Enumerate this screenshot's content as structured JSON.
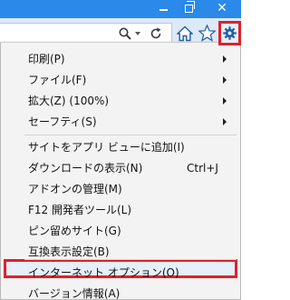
{
  "browser": {
    "window_controls": {
      "minimize": "minimize-icon",
      "restore": "restore-icon",
      "close": "✕"
    },
    "toolbar": {
      "address_icons": [
        "search-icon",
        "dropdown-arrow-icon",
        "refresh-icon"
      ],
      "buttons": [
        "home-icon",
        "favorites-star-icon",
        "gear-icon"
      ],
      "highlight_color": "#e0202a",
      "accent_color": "#2b89e9"
    }
  },
  "menu": {
    "items": [
      {
        "label": "印刷(P)",
        "has_submenu": true
      },
      {
        "label": "ファイル(F)",
        "has_submenu": true
      },
      {
        "label": "拡大(Z) (100%)",
        "has_submenu": true
      },
      {
        "label": "セーフティ(S)",
        "has_submenu": true
      },
      {
        "label": "サイトをアプリ ビューに追加(I)"
      },
      {
        "label": "ダウンロードの表示(N)",
        "shortcut": "Ctrl+J"
      },
      {
        "label": "アドオンの管理(M)"
      },
      {
        "label": "F12 開発者ツール(L)"
      },
      {
        "label": "ピン留めサイト(G)"
      },
      {
        "label": "互換表示設定(B)"
      },
      {
        "label": "インターネット オプション(O)",
        "highlighted": true
      },
      {
        "label": "バージョン情報(A)"
      }
    ]
  }
}
